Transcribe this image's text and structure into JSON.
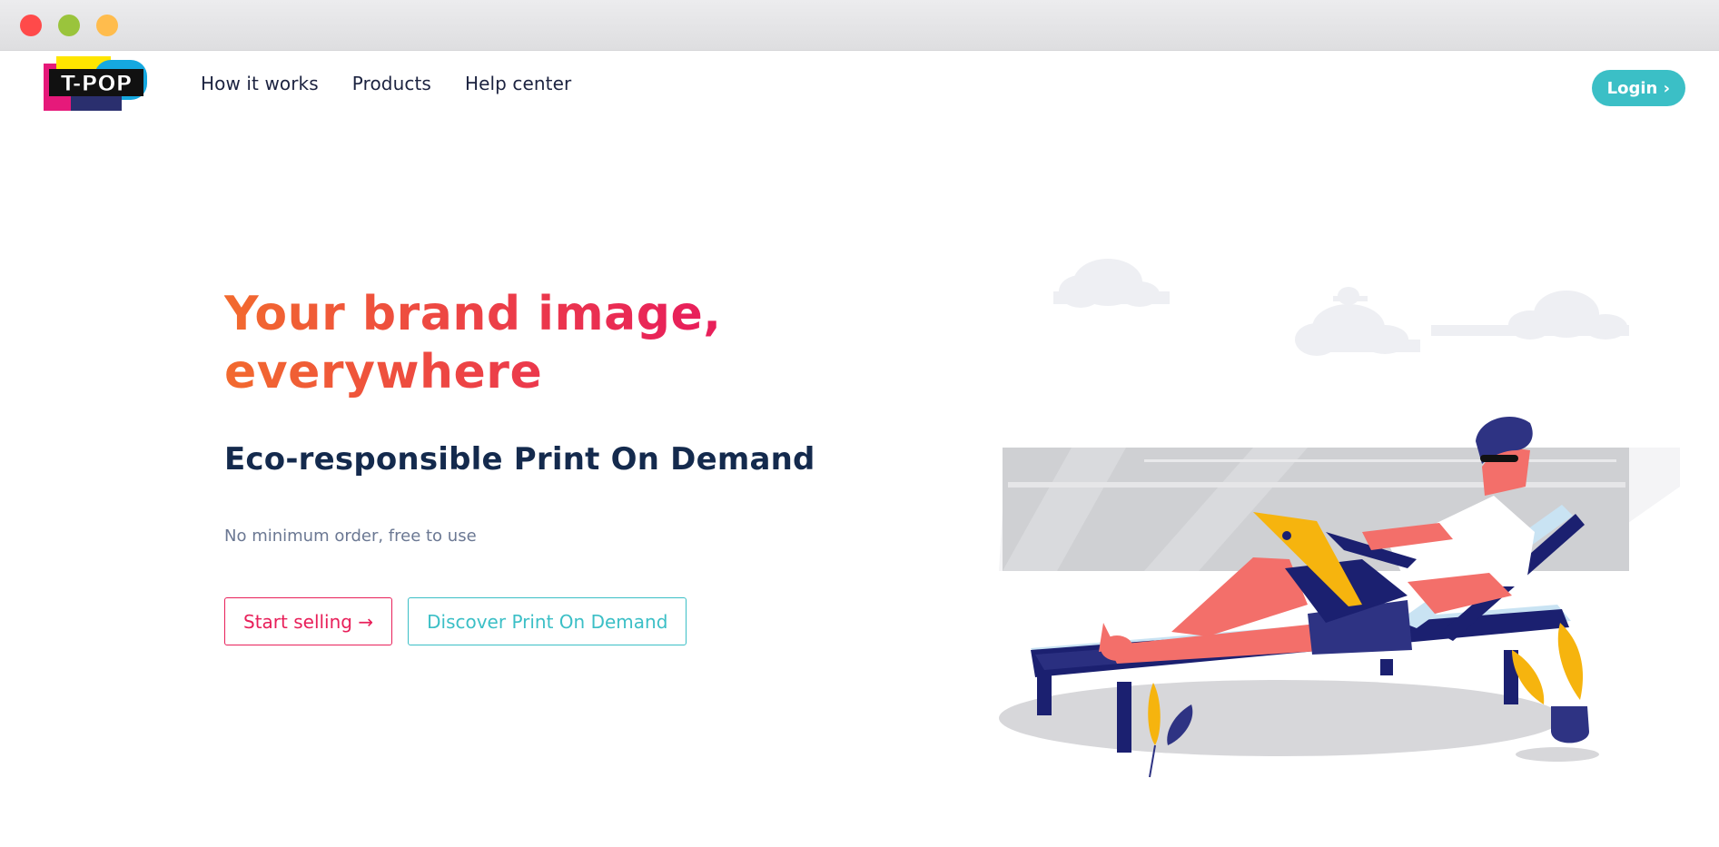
{
  "colors": {
    "accent_teal": "#3bbfc6",
    "accent_pink": "#e8205a",
    "accent_orange": "#f26a2e",
    "heading_navy": "#142a4d",
    "traffic_close": "#ff4a4a",
    "traffic_minimize": "#9ac43c",
    "traffic_maximize": "#ffbc4d"
  },
  "header": {
    "logo_text": "T-POP",
    "nav": [
      {
        "label": "How it works"
      },
      {
        "label": "Products"
      },
      {
        "label": "Help center"
      }
    ],
    "login_label": "Login ›"
  },
  "hero": {
    "title_line1": "Your brand image,",
    "title_line2": "everywhere",
    "subtitle": "Eco-responsible Print On Demand",
    "note": "No minimum order, free to use",
    "primary_cta": "Start selling →",
    "secondary_cta": "Discover Print On Demand"
  },
  "icons": {
    "illustration": "man-on-sunlounger-with-laptop-illustration",
    "logo": "tpop-logo"
  }
}
